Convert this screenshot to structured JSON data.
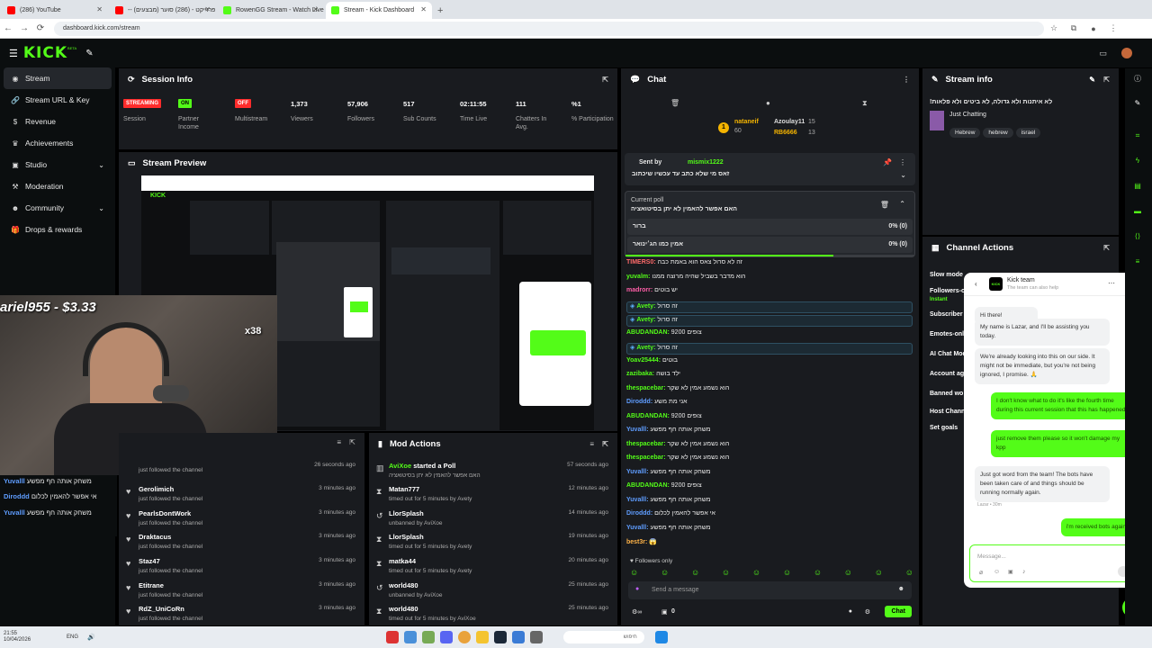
{
  "browser": {
    "tabs": [
      {
        "title": "(286) YouTube",
        "color": "#ff0000"
      },
      {
        "title": "-- (מבצעים) פרוייקט - (286) סוער",
        "color": "#ff0000"
      },
      {
        "title": "RowenGG Stream - Watch Live",
        "color": "#53fc18"
      },
      {
        "title": "Stream - Kick Dashboard",
        "color": "#53fc18"
      }
    ],
    "url": "dashboard.kick.com/stream"
  },
  "app": {
    "logo": "KICK",
    "beta": "BETA"
  },
  "sidebar": {
    "items": [
      {
        "label": "Stream",
        "icon": "broadcast-icon"
      },
      {
        "label": "Stream URL & Key",
        "icon": "link-icon"
      },
      {
        "label": "Revenue",
        "icon": "dollar-icon"
      },
      {
        "label": "Achievements",
        "icon": "trophy-icon"
      },
      {
        "label": "Studio",
        "icon": "studio-icon"
      },
      {
        "label": "Moderation",
        "icon": "hammer-icon"
      },
      {
        "label": "Community",
        "icon": "users-icon"
      },
      {
        "label": "Drops & rewards",
        "icon": "gift-icon"
      }
    ]
  },
  "session": {
    "title": "Session Info",
    "stats": [
      {
        "value": "STREAMING",
        "label": "Session"
      },
      {
        "value": "ON",
        "label": "Partner Income"
      },
      {
        "value": "OFF",
        "label": "Multistream"
      },
      {
        "value": "1,373",
        "label": "Viewers"
      },
      {
        "value": "57,906",
        "label": "Followers"
      },
      {
        "value": "517",
        "label": "Sub Counts"
      },
      {
        "value": "02:11:55",
        "label": "Time Live"
      },
      {
        "value": "111",
        "label": "Chatters In Avg."
      },
      {
        "value": "%1",
        "label": "% Participation"
      }
    ]
  },
  "preview": {
    "title": "Stream Preview",
    "overlay_text": "ariel955 - $3.33",
    "overlay_combo": "x38",
    "chat_overlay": [
      {
        "user": "Yuvalll",
        "msg": "משחק אותה חף מפשע"
      },
      {
        "user": "Diroddd",
        "msg": "אי אפשר להאמין לכלום"
      },
      {
        "user": "Yuvalll",
        "msg": "משחק אותה חף מפשע"
      }
    ]
  },
  "activity": {
    "rows": [
      {
        "user": "",
        "action": "just followed the channel",
        "time": "26 seconds ago"
      },
      {
        "user": "Gerolimich",
        "action": "just followed the channel",
        "time": "3 minutes ago"
      },
      {
        "user": "PearlsDontWork",
        "action": "just followed the channel",
        "time": "3 minutes ago"
      },
      {
        "user": "Draktacus",
        "action": "just followed the channel",
        "time": "3 minutes ago"
      },
      {
        "user": "Staz47",
        "action": "just followed the channel",
        "time": "3 minutes ago"
      },
      {
        "user": "Etitrane",
        "action": "just followed the channel",
        "time": "3 minutes ago"
      },
      {
        "user": "RdZ_UniCoRn",
        "action": "just followed the channel",
        "time": "3 minutes ago"
      }
    ]
  },
  "mod_actions": {
    "title": "Mod Actions",
    "rows": [
      {
        "user": "AviXoe",
        "action": "started a Poll",
        "detail": "האם אפשר להאמין לא יתן בסיטואציה",
        "time": "57 seconds ago",
        "icon": "poll-icon"
      },
      {
        "user": "Matan777",
        "action": "",
        "detail": "timed out for 5 minutes by Avety",
        "time": "12 minutes ago",
        "icon": "hourglass-icon"
      },
      {
        "user": "LlorSplash",
        "action": "",
        "detail": "unbanned by AviXoe",
        "time": "14 minutes ago",
        "icon": "undo-icon"
      },
      {
        "user": "LlorSplash",
        "action": "",
        "detail": "timed out for 5 minutes by Avety",
        "time": "19 minutes ago",
        "icon": "hourglass-icon"
      },
      {
        "user": "matka44",
        "action": "",
        "detail": "timed out for 5 minutes by Avety",
        "time": "20 minutes ago",
        "icon": "hourglass-icon"
      },
      {
        "user": "world480",
        "action": "",
        "detail": "unbanned by AviXoe",
        "time": "25 minutes ago",
        "icon": "undo-icon"
      },
      {
        "user": "world480",
        "action": "",
        "detail": "timed out for 5 minutes by AviXoe",
        "time": "25 minutes ago",
        "icon": "hourglass-icon"
      }
    ]
  },
  "chat": {
    "title": "Chat",
    "leaderboard": [
      {
        "rank": "1",
        "user": "nataneif",
        "score": "60"
      },
      {
        "rank": "",
        "user": "Azoulay11",
        "score": "15"
      },
      {
        "rank": "",
        "user": "RB6666",
        "score": "13"
      }
    ],
    "pinned": {
      "label": "Sent by",
      "user": "mismix1222",
      "msg": "זאס מי שלא כתב עד עכשיו שיכתוב"
    },
    "poll": {
      "label": "Current poll",
      "question": "האם אפשר להאמין לא יתן בסיטואציה",
      "options": [
        {
          "label": "ברור",
          "result": "0% (0)"
        },
        {
          "label": "אמין כמו הג׳ינואר",
          "result": "0% (0)"
        }
      ],
      "progress": 0.72
    },
    "messages": [
      {
        "user": "TIMERS0",
        "msg": "זה לא סרול צאס הוא באמת כבה",
        "color": "#ff6a6a",
        "hl": false
      },
      {
        "user": "yuvalm",
        "msg": "הוא מדבר בשביל שהיה מרוצה ממנו",
        "color": "#53fc18",
        "hl": false
      },
      {
        "user": "madrorr",
        "msg": "יש בוטים",
        "color": "#ff5fa8",
        "hl": false
      },
      {
        "user": "Avety",
        "msg": "זה סרול",
        "color": "#53fc18",
        "hl": true
      },
      {
        "user": "Avety",
        "msg": "זה סרול",
        "color": "#53fc18",
        "hl": true
      },
      {
        "user": "ABUDANDAN",
        "msg": "9200 צופים",
        "color": "#53fc18",
        "hl": false
      },
      {
        "user": "Avety",
        "msg": "זה סרול",
        "color": "#53fc18",
        "hl": true
      },
      {
        "user": "Yoav25444",
        "msg": "בוטים",
        "color": "#53fc18",
        "hl": false
      },
      {
        "user": "zazibaka",
        "msg": "ילד בושה",
        "color": "#53fc18",
        "hl": false
      },
      {
        "user": "thespacebar",
        "msg": "הוא נשמע אמין לא שקר",
        "color": "#53fc18",
        "hl": false
      },
      {
        "user": "Diroddd",
        "msg": "אני מת משע",
        "color": "#5f9dff",
        "hl": false
      },
      {
        "user": "ABUDANDAN",
        "msg": "9200 צופים",
        "color": "#53fc18",
        "hl": false
      },
      {
        "user": "Yuvalll",
        "msg": "משחק אותה חף מפשע",
        "color": "#5f9dff",
        "hl": false
      },
      {
        "user": "thespacebar",
        "msg": "הוא נשמע אמין לא שקר",
        "color": "#53fc18",
        "hl": false
      },
      {
        "user": "thespacebar",
        "msg": "הוא נשמע אמין לא שקר",
        "color": "#53fc18",
        "hl": false
      },
      {
        "user": "Yuvalll",
        "msg": "משחק אותה חף מפשע",
        "color": "#5f9dff",
        "hl": false
      },
      {
        "user": "ABUDANDAN",
        "msg": "9200 צופים",
        "color": "#53fc18",
        "hl": false
      },
      {
        "user": "Yuvalll",
        "msg": "משחק אותה חף מפשע",
        "color": "#5f9dff",
        "hl": false
      },
      {
        "user": "Diroddd",
        "msg": "אי אפשר להאמין לכלום",
        "color": "#5f9dff",
        "hl": false
      },
      {
        "user": "Yuvalll",
        "msg": "משחק אותה חף מפשע",
        "color": "#5f9dff",
        "hl": false
      },
      {
        "user": "best3r",
        "msg": "😱",
        "color": "#ffb347",
        "hl": false
      }
    ],
    "followers_only": "Followers only",
    "placeholder": "Send a message",
    "send_label": "Chat",
    "bottom_count": "0"
  },
  "stream_info": {
    "title": "Stream info",
    "stream_title": "!לא איתנות ולא גדולה, לא ביטים ולא פלאות",
    "category": "Just Chatting",
    "tags": [
      "Hebrew",
      "hebrew",
      "israel"
    ]
  },
  "channel_actions": {
    "title": "Channel Actions",
    "items": [
      "Slow mode",
      "Followers-only",
      "Subscriber",
      "Emotes-only",
      "AI Chat Mod",
      "Account ag",
      "Banned wo",
      "Host Chann",
      "Set goals"
    ],
    "instant_label": "Instant"
  },
  "kick_team": {
    "name": "Kick team",
    "subtitle": "The team can also help",
    "messages": [
      {
        "dir": "in",
        "text": "Hi there!"
      },
      {
        "dir": "in",
        "text": "My name is Lazar, and I'll be assisting you today."
      },
      {
        "dir": "in",
        "text": "We're already looking into this on our side. It might not be immediate, but you're not being ignored, I promise. 🙏"
      },
      {
        "dir": "out",
        "text": "I don't know what to do it's like the fourth time during this current session that this has happened"
      },
      {
        "dir": "out",
        "text": "just remove them please so it won't damage my kpp"
      },
      {
        "dir": "in",
        "text": "Just got word from the team! The bots have been taken care of and things should be running normally again."
      },
      {
        "dir": "out",
        "text": "i'm received bots again"
      }
    ],
    "meta": "Lazar • 30m",
    "placeholder": "Message..."
  },
  "taskbar": {
    "time": "21:55",
    "date": "10/04/2026",
    "lang": "ENG",
    "search": "חיפוש"
  },
  "colors": {
    "accent": "#53fc18",
    "bg": "#0b0e0f",
    "panel": "#191b1f",
    "red": "#ff2c2c"
  }
}
